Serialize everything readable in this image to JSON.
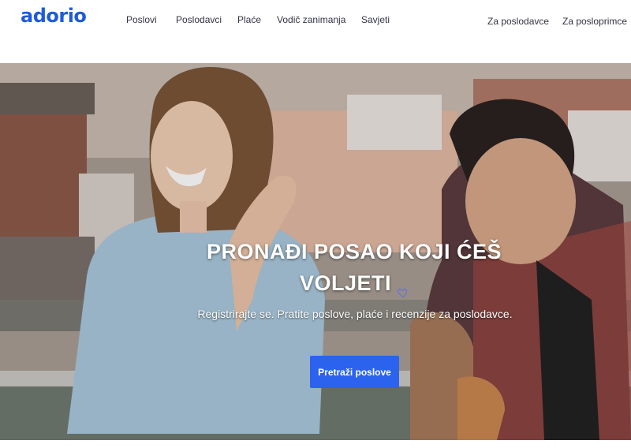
{
  "brand": {
    "logo": "adorio",
    "color": "#1f5bd8"
  },
  "nav": {
    "items": [
      {
        "label": "Poslovi"
      },
      {
        "label": "Poslodavci"
      },
      {
        "label": "Plaće"
      },
      {
        "label": "Vodič zanimanja"
      },
      {
        "label": "Savjeti"
      }
    ],
    "right": [
      {
        "label": "Za poslodavce"
      },
      {
        "label": "Za posloprimce"
      }
    ]
  },
  "hero": {
    "title_line1": "PRONAĐI POSAO KOJI ĆEŠ",
    "title_line2": "VOLJETI",
    "heart_icon": "heart-outline-icon",
    "subtitle": "Registrirajte se. Pratite poslove, plaće i recenzije za poslodavce.",
    "cta_label": "Pretraži poslove",
    "cta_color": "#2b63ef"
  }
}
